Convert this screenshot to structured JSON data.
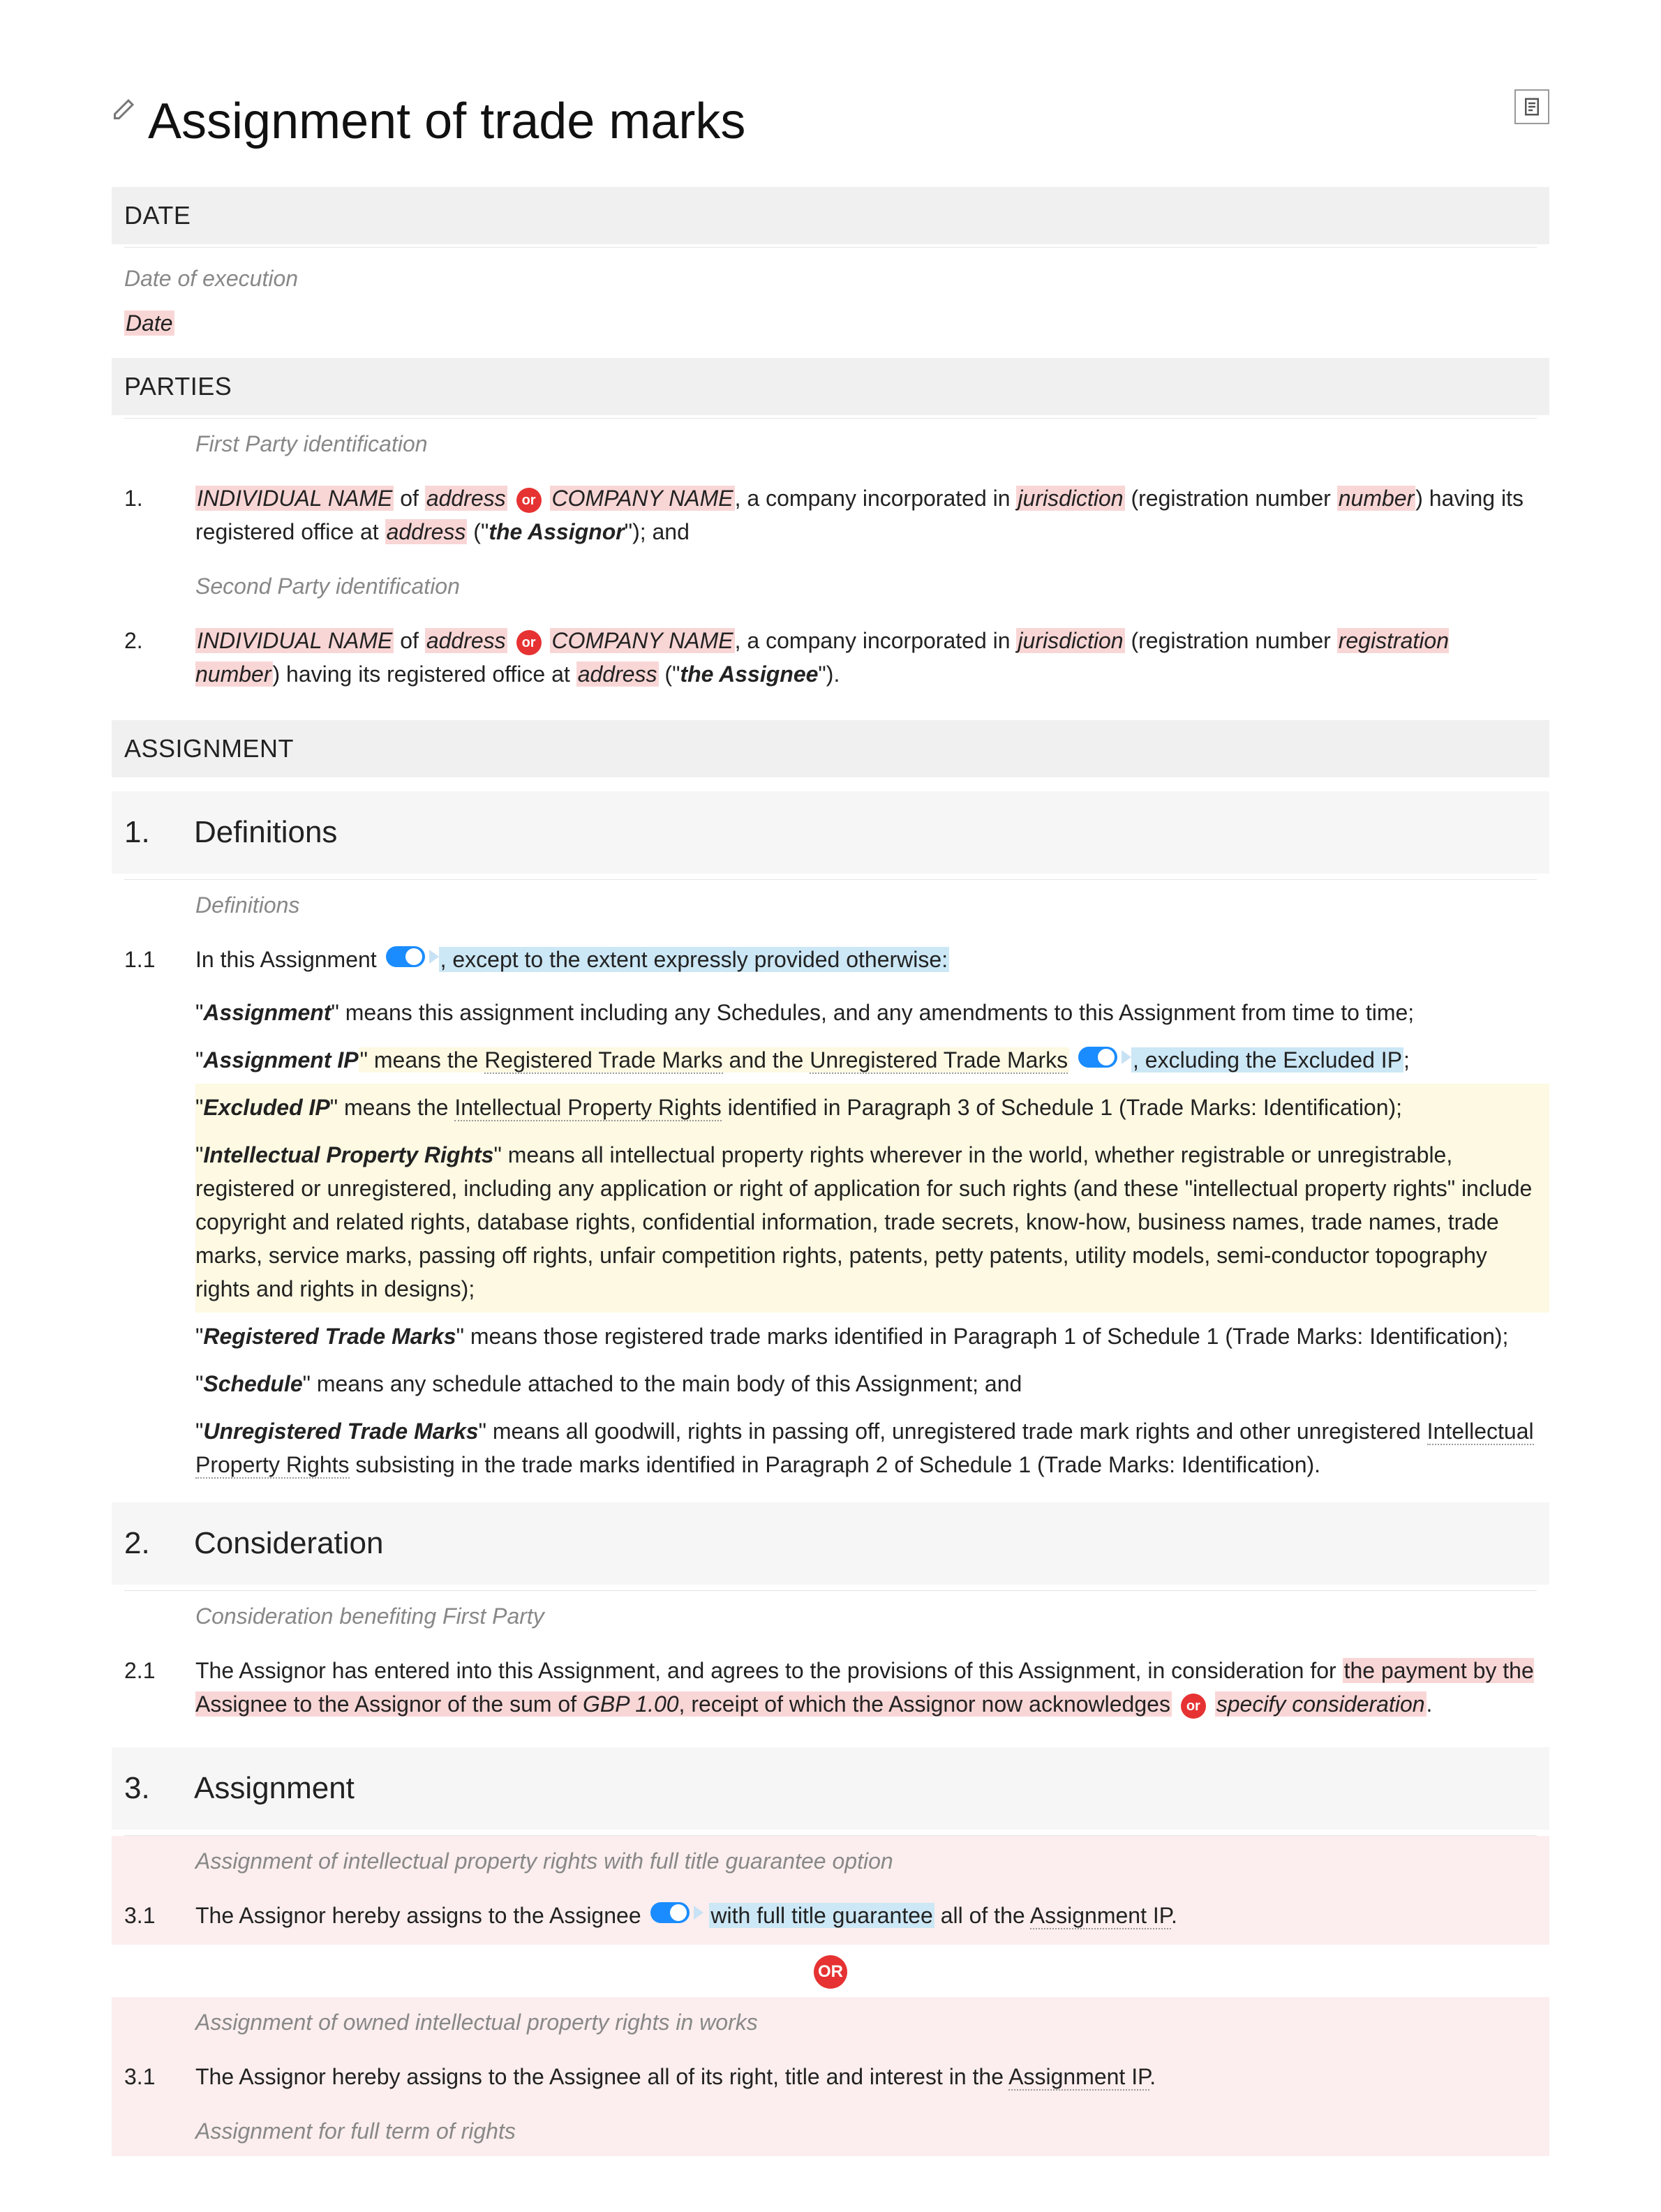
{
  "title": "Assignment of trade marks",
  "sections": {
    "date": {
      "header": "DATE",
      "note": "Date of execution",
      "value": "Date"
    },
    "parties": {
      "header": "PARTIES",
      "p1": {
        "num": "1.",
        "note": "First Party identification",
        "name": "INDIVIDUAL NAME",
        "of": " of ",
        "address": "address",
        "or": "or",
        "company": "COMPANY NAME",
        "incorp": ", a company incorporated in ",
        "jurisdiction": "jurisdiction",
        "regnum_pre": " (registration number ",
        "number": "number",
        "regnum_post": ") having its registered office at ",
        "address2": "address",
        "role_pre": " (\"",
        "role": "the Assignor",
        "role_post": "\"); and"
      },
      "p2": {
        "num": "2.",
        "note": "Second Party identification",
        "name": "INDIVIDUAL NAME",
        "of": " of ",
        "address": "address",
        "or": "or",
        "company": "COMPANY NAME",
        "incorp": ", a company incorporated in ",
        "jurisdiction": "jurisdiction",
        "regnum_pre": " (registration number ",
        "number": "registration number",
        "regnum_post": ") having its registered office at ",
        "address2": "address",
        "role_pre": " (\"",
        "role": "the Assignee",
        "role_post": "\")."
      }
    },
    "assignment_header": "ASSIGNMENT"
  },
  "s1": {
    "num": "1.",
    "title": "Definitions",
    "note": "Definitions",
    "c11": {
      "num": "1.1",
      "pre": "In this Assignment",
      "post": ", except to the extent expressly provided otherwise:"
    },
    "d_assignment": {
      "term": "Assignment",
      "body": "\" means this assignment including any Schedules, and any amendments to this Assignment from time to time;"
    },
    "d_assignmentip": {
      "term": "Assignment IP",
      "pre": "\" means the ",
      "rtm": "Registered Trade Marks",
      "and": " and the ",
      "utm": "Unregistered Trade Marks",
      "post": ", excluding the Excluded IP",
      "end": ";"
    },
    "d_excludedip": {
      "term": "Excluded IP",
      "pre": "\" means the ",
      "ipr": "Intellectual Property Rights",
      "post": " identified in Paragraph 3 of Schedule 1 (Trade Marks: Identification);"
    },
    "d_ipr": {
      "term": "Intellectual Property Rights",
      "body": "\" means all intellectual property rights wherever in the world, whether registrable or unregistrable, registered or unregistered, including any application or right of application for such rights (and these \"intellectual property rights\" include copyright and related rights, database rights, confidential information, trade secrets, know-how, business names, trade names, trade marks, service marks, passing off rights, unfair competition rights, patents, petty patents, utility models, semi-conductor topography rights and rights in designs);"
    },
    "d_rtm": {
      "term": "Registered Trade Marks",
      "body": "\" means those registered trade marks identified in Paragraph 1 of Schedule 1 (Trade Marks: Identification);"
    },
    "d_schedule": {
      "term": "Schedule",
      "body": "\" means any schedule attached to the main body of this Assignment; and"
    },
    "d_utm": {
      "term": "Unregistered Trade Marks",
      "pre": "\" means all goodwill, rights in passing off, unregistered trade mark rights and other unregistered ",
      "ipr": "Intellectual Property Rights",
      "post": " subsisting in the trade marks identified in Paragraph 2 of Schedule 1 (Trade Marks: Identification)."
    }
  },
  "s2": {
    "num": "2.",
    "title": "Consideration",
    "note": "Consideration benefiting First Party",
    "c21": {
      "num": "2.1",
      "t1": "The Assignor has entered into this Assignment, and agrees to the provisions of this Assignment, in consideration for ",
      "t2": "the payment by the Assignee to the Assignor of the sum of ",
      "amount": "GBP 1.00",
      "t3": ", receipt of which the Assignor now acknowledges",
      "or": "or",
      "t4": "specify consideration",
      "t5": "."
    }
  },
  "s3": {
    "num": "3.",
    "title": "Assignment",
    "note1": "Assignment of intellectual property rights with full title guarantee option",
    "c31a": {
      "num": "3.1",
      "t1": "The Assignor hereby assigns to the Assignee ",
      "t2": " with full title guarantee",
      "t3": " all of the ",
      "aip": "Assignment IP",
      "t4": "."
    },
    "or": "OR",
    "note2": "Assignment of owned intellectual property rights in works",
    "c31b": {
      "num": "3.1",
      "t1": "The Assignor hereby assigns to the Assignee all of its right, title and interest in the ",
      "aip": "Assignment IP",
      "t2": "."
    },
    "note3": "Assignment for full term of rights"
  }
}
